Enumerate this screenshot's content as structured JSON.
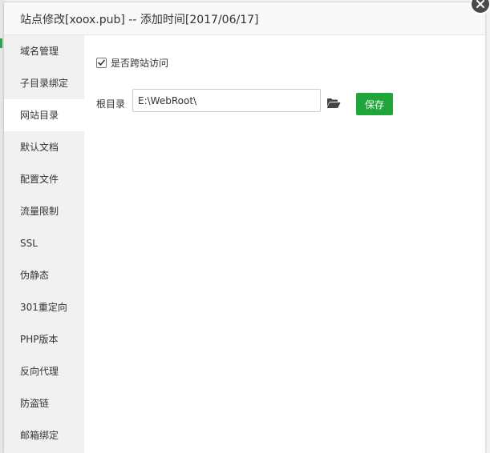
{
  "dialog": {
    "title": "站点修改[xoox.pub] -- 添加时间[2017/06/17]"
  },
  "sidebar": {
    "items": [
      {
        "label": "域名管理"
      },
      {
        "label": "子目录绑定"
      },
      {
        "label": "网站目录",
        "active": true
      },
      {
        "label": "默认文档"
      },
      {
        "label": "配置文件"
      },
      {
        "label": "流量限制"
      },
      {
        "label": "SSL"
      },
      {
        "label": "伪静态"
      },
      {
        "label": "301重定向"
      },
      {
        "label": "PHP版本"
      },
      {
        "label": "反向代理"
      },
      {
        "label": "防盗链"
      },
      {
        "label": "邮箱绑定"
      }
    ]
  },
  "content": {
    "cors_label": "是否跨站访问",
    "cors_checked": true,
    "root_label": "根目录",
    "root_value": "E:\\WebRoot\\",
    "save_label": "保存"
  },
  "colors": {
    "accent": "#20a53a",
    "sidebar_bg": "#f1f1f1"
  },
  "icons": {
    "folder": "folder-open-icon",
    "close": "close-icon",
    "check": "checkmark-icon"
  }
}
